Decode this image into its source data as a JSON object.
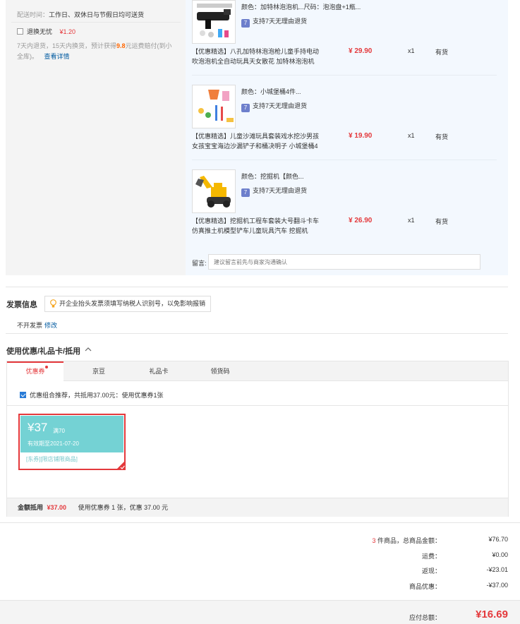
{
  "shipping": {
    "delivery_time_label": "配送时间：",
    "delivery_time_value": "工作日、双休日与节假日均可送货",
    "return_insurance_label": "退换无忧",
    "return_insurance_price": "¥1.20",
    "return_insurance_desc_1": "7天内退货，15天内换货，预计获得",
    "return_insurance_highlight": "9.8",
    "return_insurance_desc_2": "元运费赔付(到小",
    "return_insurance_desc_3": "全库)。",
    "details_link": "查看详情"
  },
  "items": [
    {
      "attr": "颜色：加特林泡泡机...尺码：泡泡盘+1瓶...",
      "service": "支持7天无理由退货",
      "name": "【优惠精选】八孔加特林泡泡枪儿童手持电动吹泡泡机全自动玩具天女散花 加特林泡泡机",
      "price": "¥ 29.90",
      "qty": "x1",
      "stock": "有货"
    },
    {
      "attr": "颜色：小城堡桶4件...",
      "service": "支持7天无理由退货",
      "name": "【优惠精选】儿童沙滩玩具套装戏水挖沙男孩女孩宝宝海边沙漏铲子和桶决明子 小城堡桶4",
      "price": "¥ 19.90",
      "qty": "x1",
      "stock": "有货"
    },
    {
      "attr": "颜色：挖掘机【颜色...",
      "service": "支持7天无理由退货",
      "name": "【优惠精选】挖掘机工程车套装大号翻斗卡车仿真推土机模型铲车儿童玩具汽车 挖掘机",
      "price": "¥ 26.90",
      "qty": "x1",
      "stock": "有货"
    }
  ],
  "memo": {
    "label": "留言:",
    "placeholder": "建议留言前先与商家沟通确认"
  },
  "invoice": {
    "title": "发票信息",
    "tip": "开企业抬头发票须填写纳税人识别号，以免影响报销",
    "type": "不开发票",
    "edit": "修改"
  },
  "coupons": {
    "title": "使用优惠/礼品卡/抵用",
    "tabs": [
      {
        "label": "优惠券"
      },
      {
        "label": "京豆"
      },
      {
        "label": "礼品卡"
      },
      {
        "label": "领货码"
      }
    ],
    "combo_text": "优惠组合推荐，共抵用37.00元：使用优惠券1张",
    "card": {
      "amount": "¥37",
      "condition": "满70",
      "expiry": "有效期至2021-07-20",
      "tag_1": "[东券]",
      "tag_2": "[限店铺限商品]"
    },
    "deduct_label": "金额抵用",
    "deduct_value": "¥37.00",
    "deduct_desc": "使用优惠券 1 张，优惠 37.00 元"
  },
  "summary": {
    "count": "3",
    "count_label": " 件商品，总商品金额：",
    "goods_total": "¥76.70",
    "shipping_label": "运费：",
    "shipping_value": "¥0.00",
    "rebate_label": "返现：",
    "rebate_value": "-¥23.01",
    "discount_label": "商品优惠：",
    "discount_value": "-¥37.00",
    "payable_label": "应付总额：",
    "payable_value": "¥16.69"
  },
  "colors": {
    "accent_red": "#e4393c",
    "link_blue": "#005aa0",
    "coupon_teal": "#74d2d4"
  }
}
